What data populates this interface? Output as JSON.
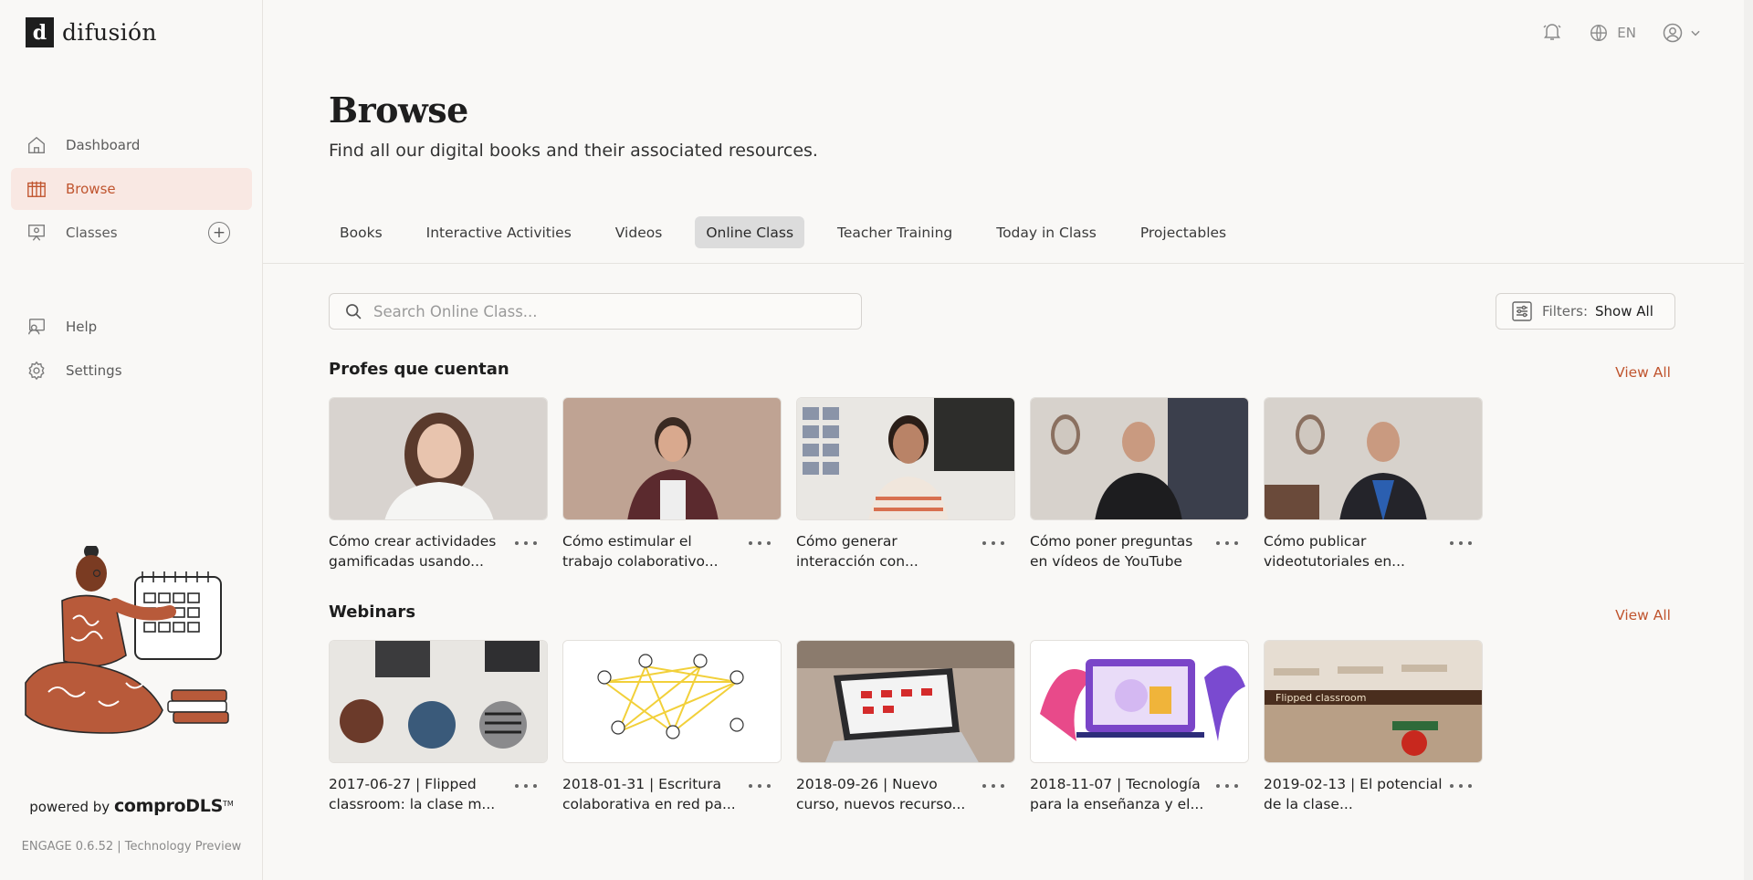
{
  "brand": {
    "mark": "d",
    "name": "difusión"
  },
  "sidebar": {
    "nav": [
      {
        "label": "Dashboard",
        "icon": "home-icon"
      },
      {
        "label": "Browse",
        "icon": "browse-icon",
        "active": true
      },
      {
        "label": "Classes",
        "icon": "classes-icon"
      }
    ],
    "nav_bottom": [
      {
        "label": "Help",
        "icon": "help-icon"
      },
      {
        "label": "Settings",
        "icon": "gear-icon"
      }
    ],
    "powered_prefix": "powered by",
    "powered_brand": "comproDLS",
    "powered_tm": "TM",
    "version": "ENGAGE 0.6.52 | Technology Preview"
  },
  "topbar": {
    "language": "EN"
  },
  "page": {
    "title": "Browse",
    "subtitle": "Find all our digital books and their associated resources."
  },
  "tabs": [
    "Books",
    "Interactive Activities",
    "Videos",
    "Online Class",
    "Teacher Training",
    "Today in Class",
    "Projectables"
  ],
  "active_tab": "Online Class",
  "search": {
    "placeholder": "Search Online Class..."
  },
  "filters": {
    "label": "Filters:",
    "value": "Show All"
  },
  "sections": [
    {
      "title": "Profes que cuentan",
      "view_all": "View All",
      "cards": [
        {
          "title": "Cómo crear actividades gamificadas usando..."
        },
        {
          "title": "Cómo estimular el trabajo colaborativo..."
        },
        {
          "title": "Cómo generar interacción con..."
        },
        {
          "title": "Cómo poner preguntas en vídeos de YouTube"
        },
        {
          "title": "Cómo publicar videotutoriales en..."
        }
      ]
    },
    {
      "title": "Webinars",
      "view_all": "View All",
      "cards": [
        {
          "title": "2017-06-27 | Flipped classroom: la clase m..."
        },
        {
          "title": "2018-01-31 | Escritura colaborativa en red pa..."
        },
        {
          "title": "2018-09-26 | Nuevo curso, nuevos recurso..."
        },
        {
          "title": "2018-11-07 | Tecnología para la enseñanza y el..."
        },
        {
          "title": "2019-02-13 | El potencial de la clase..."
        }
      ],
      "thumb_overlay_text": "Flipped classroom"
    }
  ]
}
